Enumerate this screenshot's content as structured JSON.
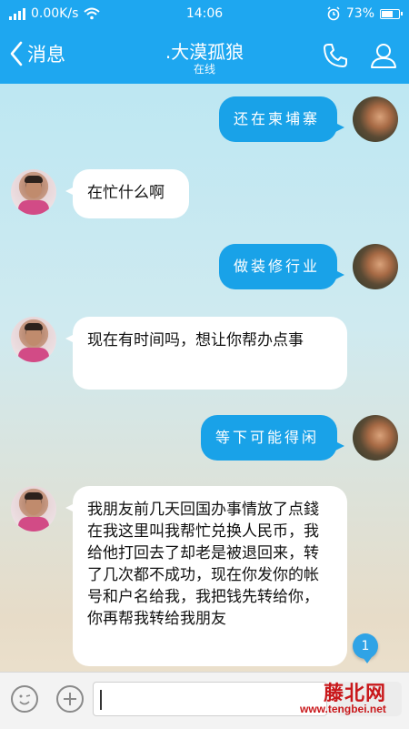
{
  "status_bar": {
    "speed": "0.00K/s",
    "time": "14:06",
    "battery": "73%",
    "battery_level": 0.73
  },
  "header": {
    "back_label": "消息",
    "contact_name": ".大漠孤狼",
    "contact_status": "在线"
  },
  "messages": [
    {
      "side": "out",
      "text": "还在柬埔寨"
    },
    {
      "side": "in",
      "text": "在忙什么啊"
    },
    {
      "side": "out",
      "text": "做装修行业"
    },
    {
      "side": "in",
      "text": "现在有时间吗，想让你帮办点事"
    },
    {
      "side": "out",
      "text": "等下可能得闲"
    },
    {
      "side": "in",
      "text": "我朋友前几天回国办事情放了点錢在我这里叫我帮忙兑换人民币，我给他打回去了却老是被退回来，转了几次都不成功，现在你发你的帐号和户名给我，我把钱先转给你，你再帮我转给我朋友"
    }
  ],
  "unread_count": "1",
  "input": {
    "value": ""
  },
  "watermark": {
    "brand": "藤北网",
    "url": "www.tengbei.net"
  },
  "colors": {
    "accent": "#1ea7f0",
    "bubble_out": "#19a2e8",
    "bubble_in": "#ffffff",
    "watermark": "#c9181b"
  },
  "icons": [
    "back-chevron-icon",
    "phone-icon",
    "contact-icon",
    "emoji-icon",
    "plus-icon",
    "wifi-icon",
    "alarm-icon"
  ]
}
